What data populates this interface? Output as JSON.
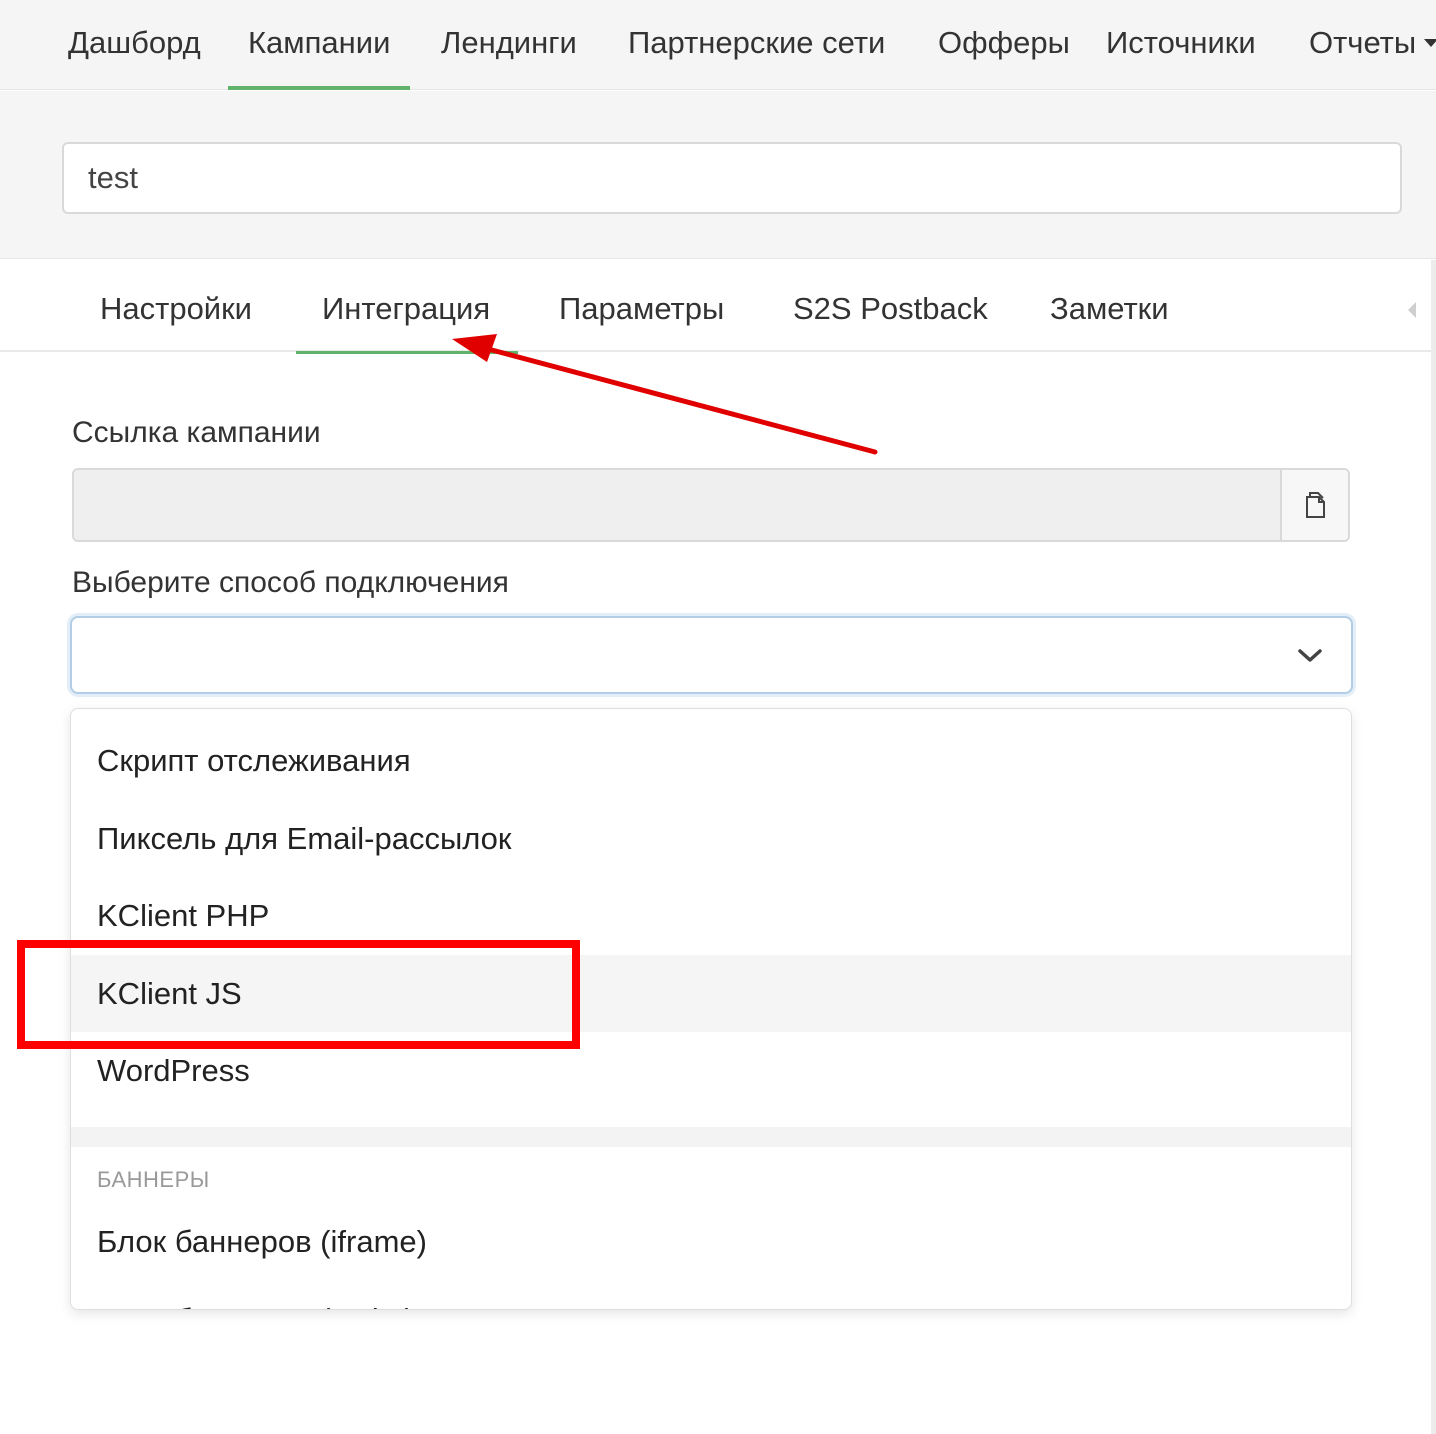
{
  "topnav": {
    "items": [
      {
        "label": "Дашборд",
        "active": false
      },
      {
        "label": "Кампании",
        "active": true
      },
      {
        "label": "Лендинги",
        "active": false
      },
      {
        "label": "Партнерские сети",
        "active": false
      },
      {
        "label": "Офферы",
        "active": false
      },
      {
        "label": "Источники",
        "active": false
      },
      {
        "label": "Отчеты",
        "active": false
      }
    ]
  },
  "campaign": {
    "name": "test"
  },
  "subtabs": {
    "items": [
      {
        "label": "Настройки"
      },
      {
        "label": "Интеграция"
      },
      {
        "label": "Параметры"
      },
      {
        "label": "S2S Postback"
      },
      {
        "label": "Заметки"
      }
    ],
    "active_index": 1
  },
  "form": {
    "link_label": "Ссылка кампании",
    "link_value": "",
    "method_label": "Выберите способ подключения",
    "method_value": ""
  },
  "dropdown": {
    "options": [
      {
        "label": "Скрипт отслеживания"
      },
      {
        "label": "Пиксель для Email-рассылок"
      },
      {
        "label": "KClient PHP"
      },
      {
        "label": "KClient JS"
      },
      {
        "label": "WordPress"
      }
    ],
    "hovered_index": 3,
    "group_header": "БАННЕРЫ",
    "group_options": [
      {
        "label": "Блок баннеров (iframe)"
      },
      {
        "label": "Блок баннеров (script)"
      }
    ]
  },
  "colors": {
    "accent_green": "#62b36a",
    "annotation_red": "#ff0000",
    "focus_blue": "#b3cde6"
  },
  "icons": {
    "copy": "copy-icon",
    "select": "chevron-down-icon",
    "nav_dropdown": "caret-down-icon",
    "tabs_scroll": "caret-left-icon"
  }
}
